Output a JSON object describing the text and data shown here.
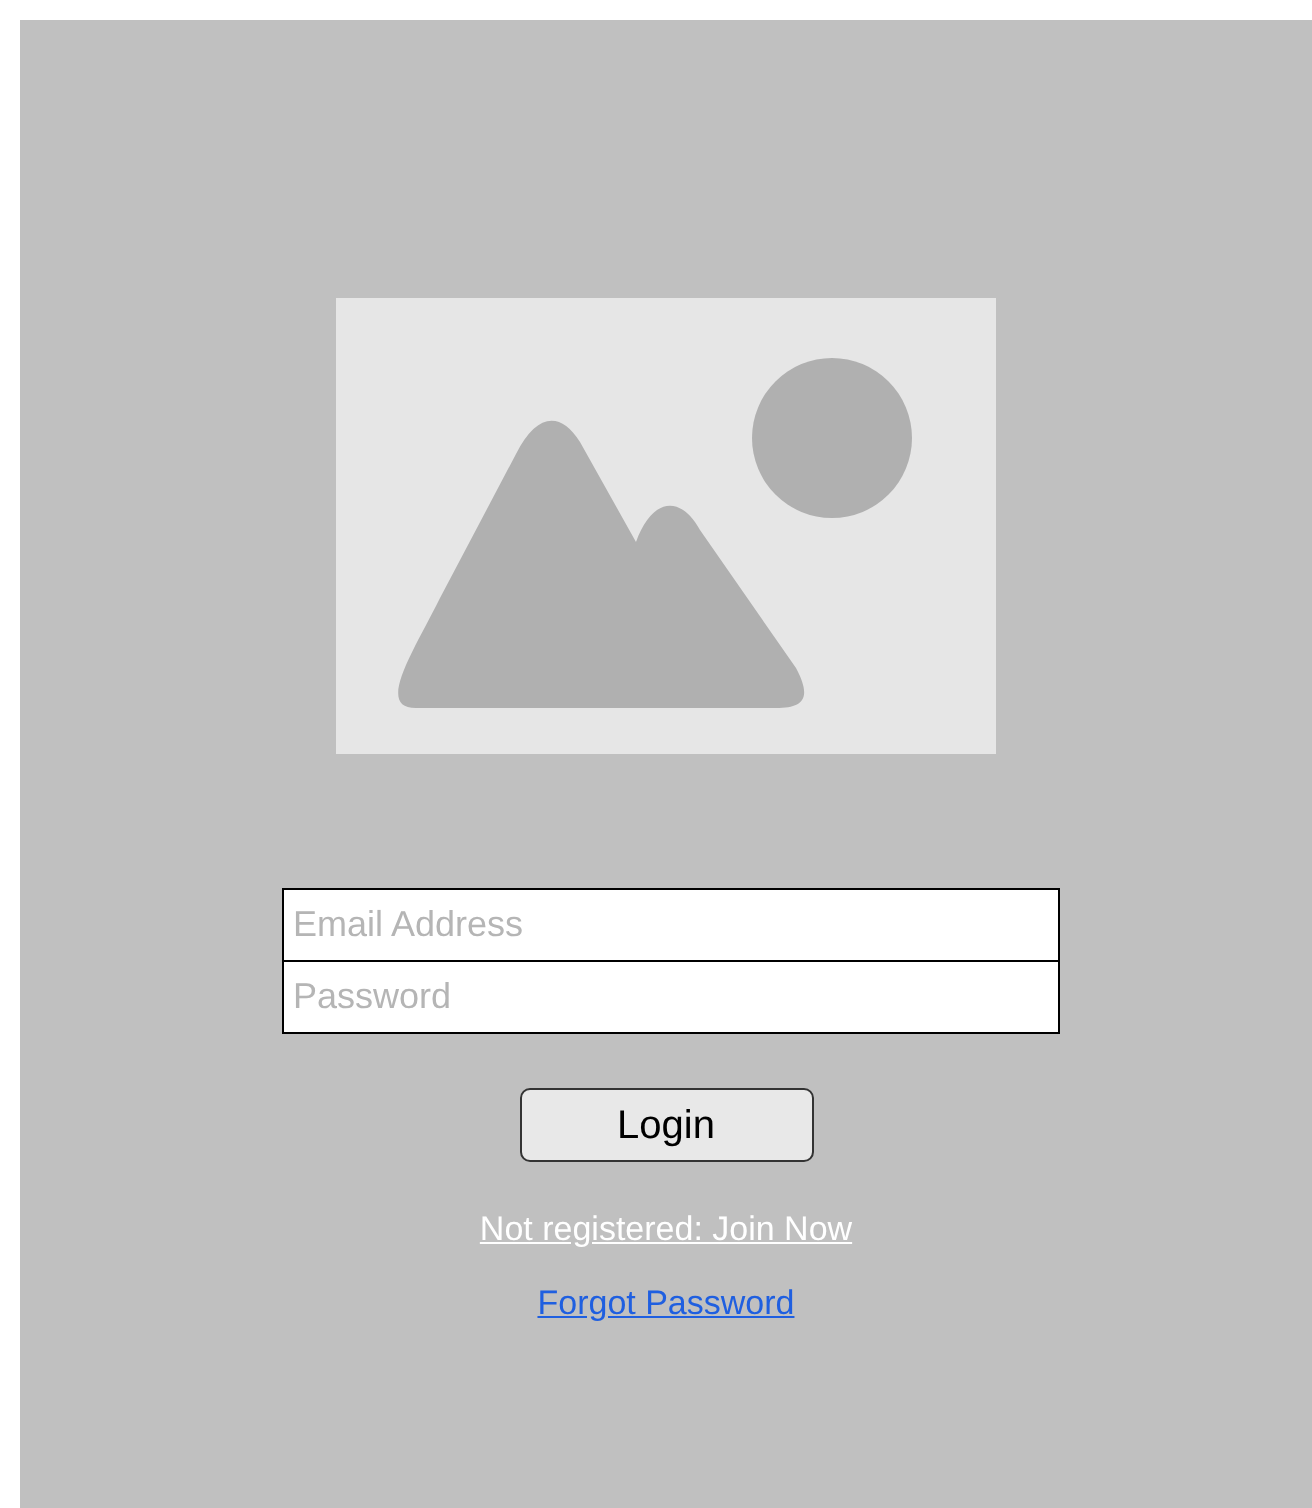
{
  "fields": [
    {
      "placeholder": "Email Address"
    },
    {
      "placeholder": "Password"
    }
  ],
  "login_button": "Login",
  "links": [
    {
      "label": "Not registered: Join Now",
      "kind": "plain"
    },
    {
      "label": "Forgot Password",
      "kind": "accent"
    }
  ]
}
